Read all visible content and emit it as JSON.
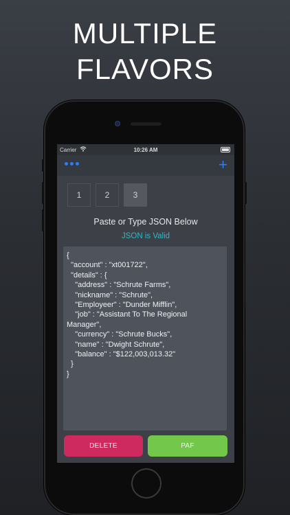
{
  "headline": {
    "line1": "MULTIPLE",
    "line2": "FLAVORS"
  },
  "status_bar": {
    "carrier": "Carrier",
    "time": "10:26 AM"
  },
  "nav": {
    "menu_icon": "more-dots-icon",
    "add_icon": "plus-icon",
    "add_label": "+"
  },
  "tabs": [
    {
      "label": "1",
      "selected": false
    },
    {
      "label": "2",
      "selected": false
    },
    {
      "label": "3",
      "selected": true
    }
  ],
  "prompt_text": "Paste or Type JSON Below",
  "validation_text": "JSON is Valid",
  "json_text": "{\n  \"account\" : \"xt001722\",\n  \"details\" : {\n    \"address\" : \"Schrute Farms\",\n    \"nickname\" : \"Schrute\",\n    \"Employeer\" : \"Dunder Mifflin\",\n    \"job\" : \"Assistant To The Regional Manager\",\n    \"currency\" : \"Schrute Bucks\",\n    \"name\" : \"Dwight Schrute\",\n    \"balance\" : \"$122,003,013.32\"\n  }\n}",
  "buttons": {
    "delete": "DELETE",
    "paf": "PAF"
  },
  "colors": {
    "accent": "#2f7df6",
    "valid": "#2fb8c8",
    "delete": "#cf2a60",
    "paf": "#73c74b"
  }
}
